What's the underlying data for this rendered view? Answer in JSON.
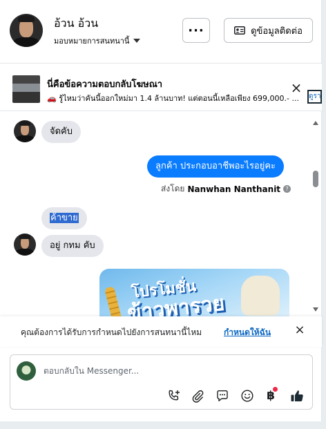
{
  "header": {
    "contact_name": "อ้วน อ้วน",
    "assign_label": "มอบหมายการสนทนานี้",
    "more_label": "···",
    "contact_info_label": "ดูข้อมูลติดต่อ"
  },
  "ad_banner": {
    "title": "นี่คือข้อความตอบกลับโฆษณา",
    "text": "🚗 รู้ไหมว่าคันนี้ออกใหม่มา 1.4 ล้านบาท! แต่ตอนนี้เหลือเพียง 699,000.- ...",
    "close": "×",
    "link": "ดูรา"
  },
  "messages": [
    {
      "side": "in",
      "text": "จัดคับ"
    },
    {
      "side": "out",
      "text": "ลูกค้า  ประกอบอาชีพอะไรอยู่คะ"
    },
    {
      "side": "in",
      "text": "ค้าขาย"
    },
    {
      "side": "in",
      "text": "อยู่ กทม คับ"
    }
  ],
  "sent_by": {
    "prefix": "ส่งโดย",
    "name": "Nanwhan Nanthanit",
    "help": "?"
  },
  "promo": {
    "line1": "โปรโมชั่น",
    "line2": "ข้าวพารวย"
  },
  "assign_prompt": {
    "text": "คุณต้องการได้รับการกำหนดไปยังการสนทนานี้ไหม",
    "link": "กำหนดให้ฉัน",
    "close": "×"
  },
  "composer": {
    "placeholder": "ตอบกลับใน Messenger...",
    "icons": [
      "call-add-icon",
      "attachment-icon",
      "saved-reply-icon",
      "emoji-icon",
      "baht-icon",
      "like-icon"
    ],
    "baht_symbol": "฿"
  },
  "colors": {
    "accent": "#0a7cff",
    "link": "#0a66c2",
    "notification": "#f02849"
  }
}
